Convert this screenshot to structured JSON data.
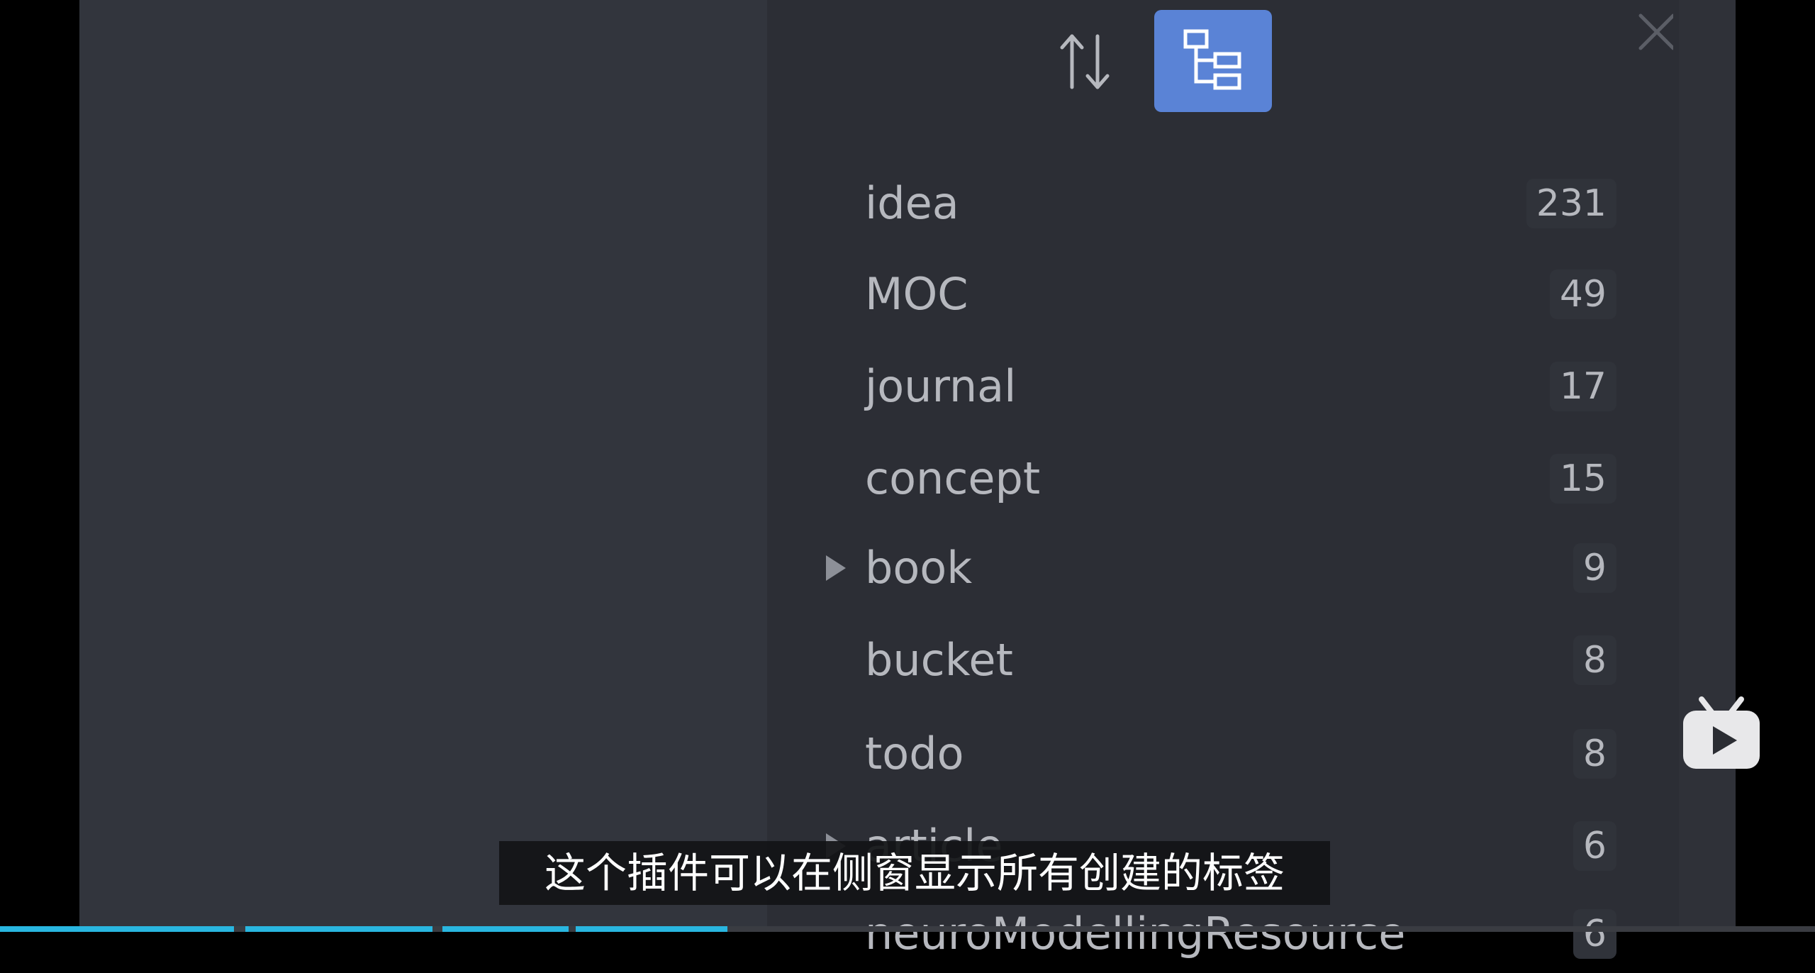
{
  "toolbar": {
    "sort_icon": "sort-arrows-icon",
    "tree_icon": "tree-view-icon",
    "tree_active_color": "#5a83d6",
    "close_icon": "close-icon"
  },
  "tags": [
    {
      "label": "idea",
      "count": "231",
      "expandable": false
    },
    {
      "label": "MOC",
      "count": "49",
      "expandable": false
    },
    {
      "label": "journal",
      "count": "17",
      "expandable": false
    },
    {
      "label": "concept",
      "count": "15",
      "expandable": false
    },
    {
      "label": "book",
      "count": "9",
      "expandable": true
    },
    {
      "label": "bucket",
      "count": "8",
      "expandable": false
    },
    {
      "label": "todo",
      "count": "8",
      "expandable": false
    },
    {
      "label": "article",
      "count": "6",
      "expandable": true
    },
    {
      "label": "neuroModellingResource",
      "count": "6",
      "expandable": false
    }
  ],
  "subtitle": "这个插件可以在侧窗显示所有创建的标签",
  "watermark": "bilibili-tv-icon",
  "colors": {
    "accent": "#5a83d6",
    "progress": "#29b6e0"
  }
}
